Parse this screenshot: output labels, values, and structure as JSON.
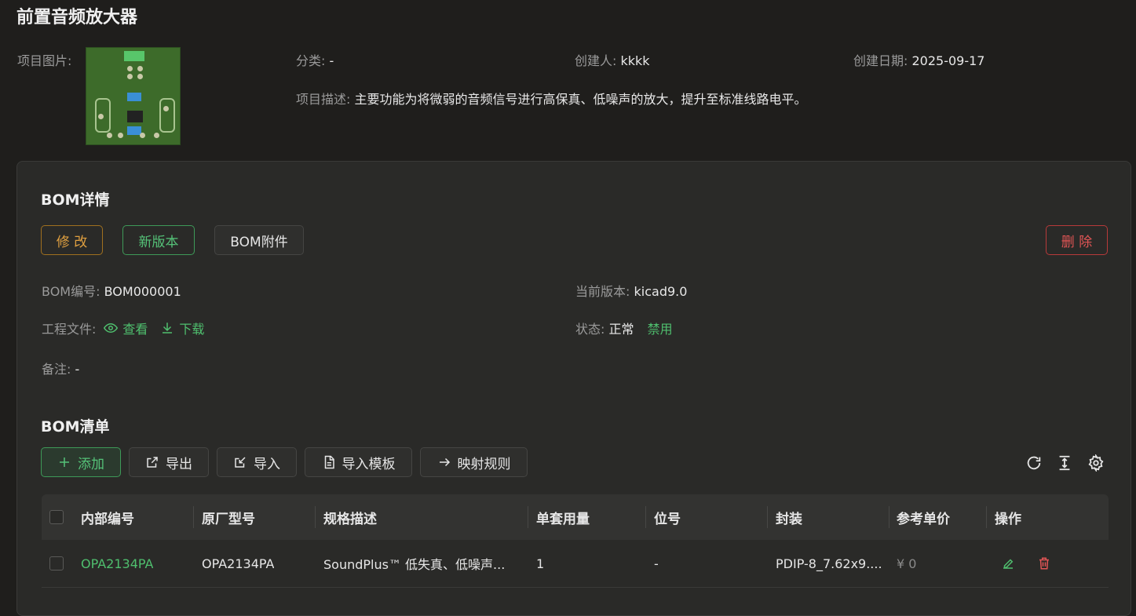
{
  "project": {
    "title": "前置音频放大器",
    "image_label": "项目图片:",
    "category_label": "分类:",
    "category_value": "-",
    "creator_label": "创建人:",
    "creator_value": "kkkk",
    "created_date_label": "创建日期:",
    "created_date_value": "2025-09-17",
    "desc_label": "项目描述:",
    "desc_value": "主要功能为将微弱的音频信号进行高保真、低噪声的放大，提升至标准线路电平。"
  },
  "bom": {
    "section_title": "BOM详情",
    "buttons": {
      "edit": "修 改",
      "new_version": "新版本",
      "attachment": "BOM附件",
      "delete": "删 除"
    },
    "number_label": "BOM编号:",
    "number_value": "BOM000001",
    "version_label": "当前版本:",
    "version_value": "kicad9.0",
    "project_file_label": "工程文件:",
    "view_link": "查看",
    "download_link": "下载",
    "status_label": "状态:",
    "status_value": "正常",
    "disable_link": "禁用",
    "remark_label": "备注:",
    "remark_value": "-"
  },
  "bom_list": {
    "section_title": "BOM清单",
    "toolbar": {
      "add": "添加",
      "export": "导出",
      "import": "导入",
      "import_template": "导入模板",
      "mapping_rules": "映射规则"
    },
    "columns": [
      "内部编号",
      "原厂型号",
      "规格描述",
      "单套用量",
      "位号",
      "封装",
      "参考单价",
      "操作"
    ],
    "rows": [
      {
        "internal_no": "OPA2134PA",
        "mfr_part": "OPA2134PA",
        "spec": "SoundPlus™ 低失真、低噪声...",
        "qty": "1",
        "designator": "-",
        "package": "PDIP-8_7.62x9....",
        "price": "¥ 0"
      }
    ]
  },
  "colors": {
    "accent_green": "#4fbf6e",
    "warning": "#e0a040",
    "danger": "#e05555",
    "background": "#1f1e1c",
    "card": "#2a2a28"
  },
  "icons": [
    "eye-icon",
    "download-icon",
    "plus-icon",
    "export-icon",
    "import-icon",
    "file-icon",
    "arrow-right-icon",
    "refresh-icon",
    "column-height-icon",
    "settings-icon",
    "edit-icon",
    "delete-icon"
  ]
}
